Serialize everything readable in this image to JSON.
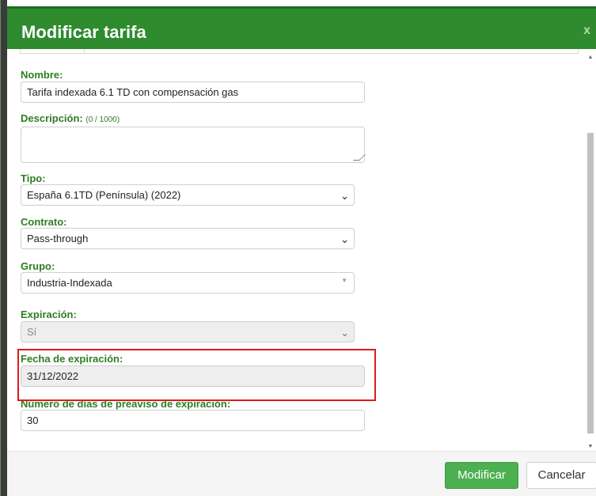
{
  "header": {
    "title": "Modificar tarifa",
    "close_label": "x"
  },
  "form": {
    "nombre": {
      "label": "Nombre:",
      "value": "Tarifa indexada 6.1 TD con compensación gas"
    },
    "descripcion": {
      "label": "Descripción:",
      "counter": "(0 / 1000)"
    },
    "tipo": {
      "label": "Tipo:",
      "value": "España 6.1TD (Península) (2022)"
    },
    "contrato": {
      "label": "Contrato:",
      "value": "Pass-through"
    },
    "grupo": {
      "label": "Grupo:",
      "value": "Industria-Indexada"
    },
    "expiracion": {
      "label": "Expiración:",
      "value": "Sí"
    },
    "fecha_expiracion": {
      "label": "Fecha de expiración:",
      "value": "31/12/2022"
    },
    "dias_preaviso": {
      "label": "Número de días de preaviso de expiración:",
      "value": "30"
    }
  },
  "footer": {
    "modify_label": "Modificar",
    "cancel_label": "Cancelar"
  },
  "colors": {
    "accent": "#2e8b2e",
    "label": "#2e7d22",
    "highlight": "#e01a1a"
  }
}
